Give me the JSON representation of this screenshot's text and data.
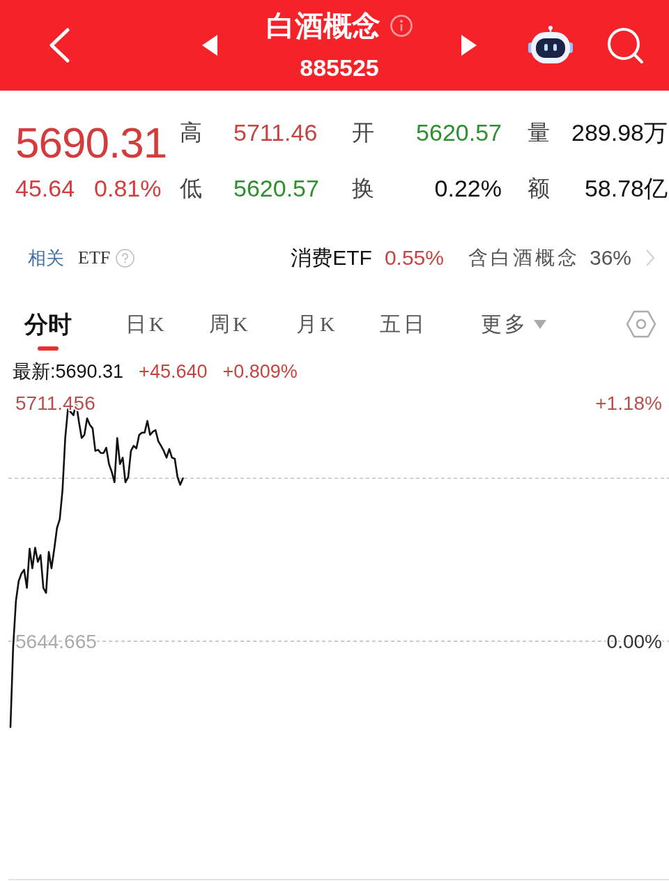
{
  "header": {
    "title": "白酒概念",
    "code": "885525"
  },
  "quote": {
    "price": "5690.31",
    "change": "45.64",
    "change_pct": "0.81%",
    "color": "#d23c3c",
    "fields": [
      {
        "label": "高",
        "value": "5711.46",
        "color": "#c4453f"
      },
      {
        "label": "开",
        "value": "5620.57",
        "color": "#2e8f2e"
      },
      {
        "label": "量",
        "value": "289.98万",
        "color": "#111111"
      },
      {
        "label": "低",
        "value": "5620.57",
        "color": "#2e8f2e"
      },
      {
        "label": "换",
        "value": "0.22%",
        "color": "#111111"
      },
      {
        "label": "额",
        "value": "58.78亿",
        "color": "#111111"
      }
    ]
  },
  "related_etf": {
    "label": "相关",
    "sublabel": "ETF",
    "name": "消费ETF",
    "change": "0.55%",
    "color": "#c4453f",
    "holding_label": "含白酒概念",
    "holding_pct": "36%"
  },
  "tabs": [
    {
      "label": "分时",
      "selected": true,
      "dropdown": false
    },
    {
      "label": "日K",
      "selected": false,
      "dropdown": false
    },
    {
      "label": "周K",
      "selected": false,
      "dropdown": false
    },
    {
      "label": "月K",
      "selected": false,
      "dropdown": false
    },
    {
      "label": "五日",
      "selected": false,
      "dropdown": false
    },
    {
      "label": "更多",
      "selected": false,
      "dropdown": true
    }
  ],
  "chart_info": {
    "latest": "最新:5690.31",
    "change": "+45.640",
    "change_pct": "+0.809%",
    "color": "#c4453f"
  },
  "chart": {
    "chart_data": {
      "type": "line",
      "categories": [
        null,
        null,
        null,
        null,
        null,
        null,
        null,
        null,
        null,
        null,
        null,
        null,
        null,
        null,
        null,
        null,
        null,
        null,
        null,
        null,
        null,
        null,
        null,
        null,
        null,
        null,
        null,
        null,
        null,
        null,
        null,
        null,
        null,
        null,
        null,
        null,
        null,
        null,
        null,
        null,
        null,
        null,
        null,
        null,
        null,
        null,
        null,
        null,
        null,
        null,
        null,
        null,
        null,
        null,
        null,
        null,
        null,
        null,
        null,
        null,
        null,
        null,
        null,
        null,
        null,
        null,
        null,
        null,
        null,
        null,
        null,
        null,
        null,
        null,
        null,
        null,
        null,
        null,
        null,
        null,
        null,
        null,
        null,
        null,
        null,
        null,
        null,
        null,
        null,
        null,
        null,
        null,
        null,
        null,
        null,
        null,
        null,
        null,
        null,
        null,
        null,
        null,
        null,
        null,
        null,
        null,
        null,
        null,
        null,
        null,
        null,
        null,
        null,
        null,
        null,
        null,
        null,
        null,
        null,
        null,
        null,
        null,
        null,
        null,
        null,
        null,
        null,
        null,
        null,
        null,
        null,
        null,
        null,
        null,
        null,
        null,
        null,
        null,
        null,
        null,
        null,
        null,
        null,
        null,
        null,
        null,
        null,
        null,
        null,
        null,
        null,
        null,
        null,
        null,
        null,
        null,
        null,
        null,
        null,
        null,
        null,
        null,
        null,
        null,
        null,
        null,
        null,
        null,
        null,
        null,
        null,
        null,
        null,
        null,
        null,
        null,
        null,
        null,
        null,
        null,
        null,
        null,
        null,
        null,
        null,
        null,
        null,
        null,
        null,
        null,
        null,
        null,
        null,
        null,
        null,
        null,
        null,
        null,
        null,
        null,
        null,
        null,
        null,
        null,
        null,
        null,
        null,
        null,
        null,
        null,
        null,
        null,
        null,
        null,
        null,
        null,
        null,
        null,
        null,
        null,
        null,
        null,
        null,
        null,
        null,
        null,
        null,
        null,
        null,
        null,
        null,
        null,
        null,
        null,
        null,
        null,
        null,
        null,
        null,
        null,
        null
      ],
      "series": [
        {
          "color": "#111111",
          "values": [
            5620.6,
            5643.2,
            5656.0,
            5661.5,
            5663.6,
            5664.7,
            5659.6,
            5670.6,
            5665.1,
            5670.9,
            5666.9,
            5668.8,
            5659.6,
            5658.2,
            5669.7,
            5665.1,
            5670.6,
            5676.4,
            5678.8,
            5687.0,
            5701.6,
            5709.8,
            5708.9,
            5708.0,
            5711.4,
            5706.2,
            5701.6,
            5702.5,
            5707.1,
            5705.3,
            5704.3,
            5698.0,
            5698.3,
            5697.4,
            5697.4,
            5698.9,
            5694.3,
            5692.1,
            5689.2,
            5701.6,
            5694.3,
            5696.1,
            5689.2,
            5690.7,
            5698.0,
            5699.4,
            5698.7,
            5702.5,
            5703.1,
            5703.1,
            5706.4,
            5702.5,
            5703.4,
            5703.8,
            5700.7,
            5699.4,
            5698.0,
            5696.1,
            5698.5,
            5696.1,
            5695.8,
            5690.7,
            5688.5,
            5690.3,
            null,
            null,
            null,
            null,
            null,
            null,
            null,
            null,
            null,
            null,
            null,
            null,
            null,
            null,
            null,
            null,
            null,
            null,
            null,
            null,
            null,
            null,
            null,
            null,
            null,
            null,
            null,
            null,
            null,
            null,
            null,
            null,
            null,
            null,
            null,
            null,
            null,
            null,
            null,
            null,
            null,
            null,
            null,
            null,
            null,
            null,
            null,
            null,
            null,
            null,
            null,
            null,
            null,
            null,
            null,
            null,
            null,
            null,
            null,
            null,
            null,
            null,
            null,
            null,
            null,
            null,
            null,
            null,
            null,
            null,
            null,
            null,
            null,
            null,
            null,
            null,
            null,
            null,
            null,
            null,
            null,
            null,
            null,
            null,
            null,
            null,
            null,
            null,
            null,
            null,
            null,
            null,
            null,
            null,
            null,
            null,
            null,
            null,
            null,
            null,
            null,
            null,
            null,
            null,
            null,
            null,
            null,
            null,
            null,
            null,
            null,
            null,
            null,
            null,
            null,
            null,
            null,
            null,
            null,
            null,
            null,
            null,
            null,
            null,
            null,
            null,
            null,
            null,
            null,
            null,
            null,
            null,
            null,
            null,
            null,
            null,
            null,
            null,
            null,
            null,
            null,
            null,
            null,
            null,
            null,
            null,
            null,
            null,
            null,
            null,
            null,
            null,
            null,
            null,
            null,
            null,
            null,
            null,
            null,
            null,
            null,
            null,
            null,
            null,
            null,
            null,
            null,
            null,
            null,
            null,
            null,
            null,
            null,
            null,
            null,
            null,
            null
          ]
        }
      ],
      "ylim": [
        5577.874,
        5711.456
      ],
      "yticks": [
        {
          "value": 5711.456,
          "label": "5711.456"
        },
        {
          "value": 5644.665,
          "label": "5644.665"
        }
      ],
      "ref_lines": [
        {
          "axis": "y",
          "value": 5690.3
        }
      ]
    },
    "right_labels": [
      "+1.18%",
      "0.00%"
    ]
  }
}
